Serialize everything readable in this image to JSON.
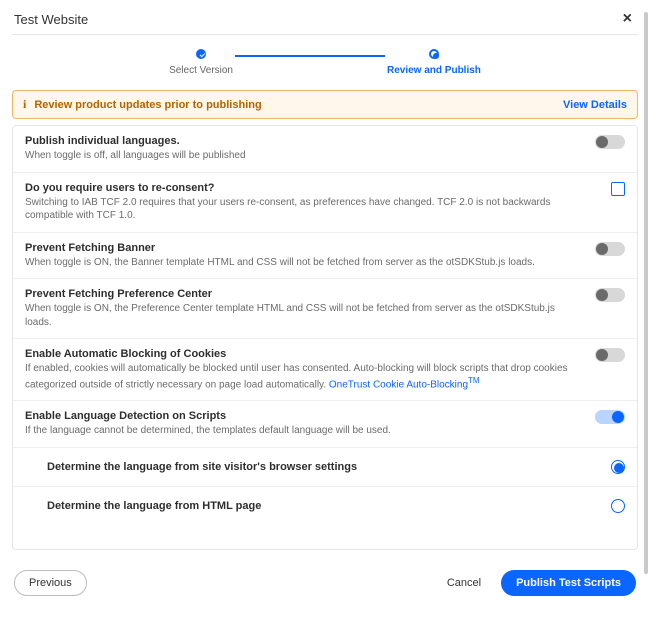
{
  "header": {
    "title": "Test Website",
    "close_icon": "×"
  },
  "stepper": {
    "steps": [
      {
        "label": "Select Version",
        "state": "done"
      },
      {
        "label": "Review and Publish",
        "state": "active"
      }
    ]
  },
  "alert": {
    "icon": "i",
    "text": "Review product updates prior to publishing",
    "link": "View Details"
  },
  "options": [
    {
      "id": "publish-langs",
      "title": "Publish individual languages.",
      "desc": "When toggle is off, all languages will be published",
      "control": "toggle",
      "value": false
    },
    {
      "id": "reconsent",
      "title": "Do you require users to re-consent?",
      "desc": "Switching to IAB TCF 2.0 requires that your users re-consent, as preferences have changed. TCF 2.0 is not backwards compatible with TCF 1.0.",
      "control": "checkbox",
      "value": false
    },
    {
      "id": "prevent-banner",
      "title": "Prevent Fetching Banner",
      "desc": "When toggle is ON, the Banner template HTML and CSS will not be fetched from server as the otSDKStub.js loads.",
      "control": "toggle",
      "value": false
    },
    {
      "id": "prevent-pc",
      "title": "Prevent Fetching Preference Center",
      "desc": "When toggle is ON, the Preference Center template HTML and CSS will not be fetched from server as the otSDKStub.js loads.",
      "control": "toggle",
      "value": false
    },
    {
      "id": "auto-block",
      "title": "Enable Automatic Blocking of Cookies",
      "desc_pre": "If enabled, cookies will automatically be blocked until user has consented. Auto-blocking will block scripts that drop cookies categorized outside of strictly necessary on page load automatically. ",
      "desc_link": "OneTrust Cookie Auto-Blocking",
      "desc_sup": "TM",
      "control": "toggle",
      "value": false
    },
    {
      "id": "lang-detect",
      "title": "Enable Language Detection on Scripts",
      "desc": "If the language cannot be determined, the templates default language will be used.",
      "control": "toggle",
      "value": true
    }
  ],
  "lang_radios": {
    "selected": 0,
    "options": [
      {
        "label": "Determine the language from site visitor's browser settings"
      },
      {
        "label": "Determine the language from HTML page"
      }
    ]
  },
  "footer": {
    "previous": "Previous",
    "cancel": "Cancel",
    "publish": "Publish Test Scripts"
  },
  "colors": {
    "accent": "#0a66ff",
    "warn_border": "#f3b56a",
    "warn_bg": "#fff7eb",
    "warn_text": "#b46400"
  }
}
